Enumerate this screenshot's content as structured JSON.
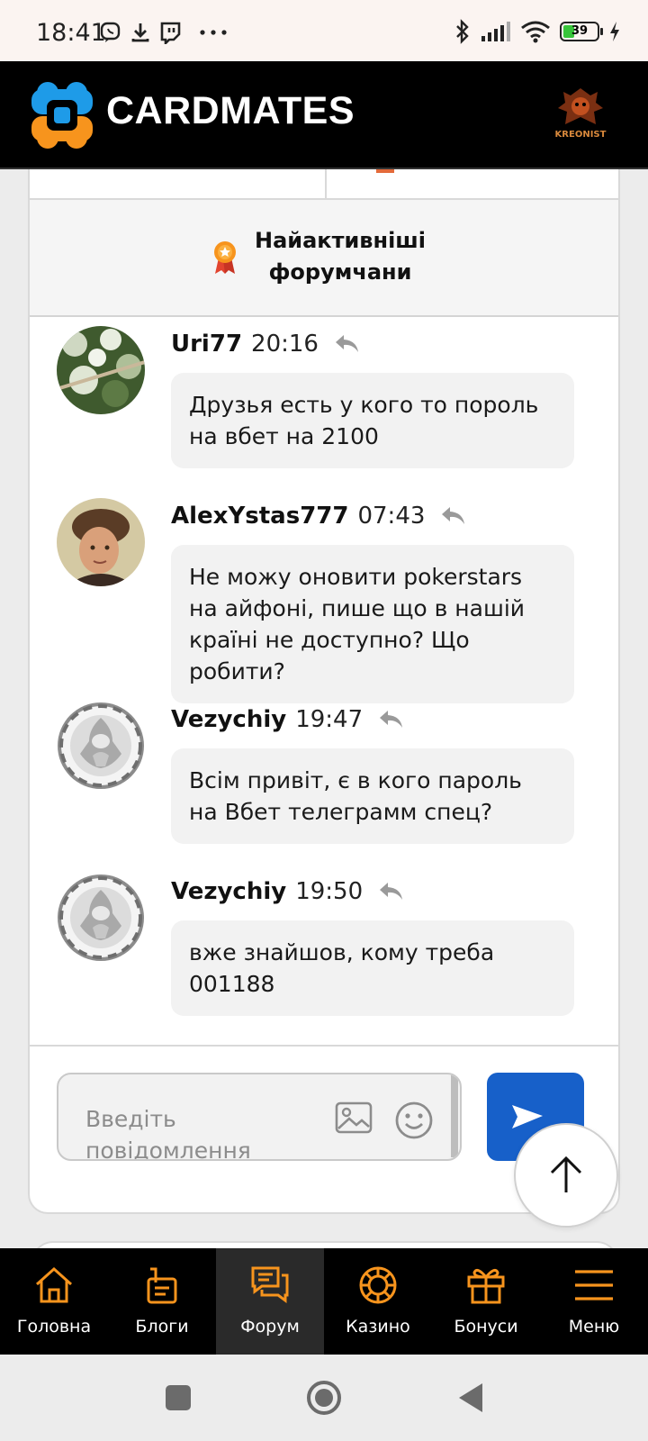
{
  "status_bar": {
    "time": "18:41",
    "left_icons": [
      "viber-icon",
      "download-icon",
      "twitch-icon",
      "more-dots-icon"
    ],
    "right_icons": [
      "bluetooth-icon",
      "signal-icon",
      "wifi-icon",
      "battery-icon",
      "charging-icon"
    ],
    "battery_level": "39"
  },
  "header": {
    "logo_text": "CARDMATES",
    "profile_badge_text": "KREONIST"
  },
  "section": {
    "title": "Найактивніші форумчани"
  },
  "messages": [
    {
      "user": "Uri77",
      "time": "20:16",
      "text": "Друзья есть у кого то пороль на вбет на 2100"
    },
    {
      "user": "AlexYstas777",
      "time": "07:43",
      "text": "Не можу оновити pokerstars на айфоні, пише що в нашій країні не доступно? Що робити?"
    },
    {
      "user": "Vezychiy",
      "time": "19:47",
      "text": "Всім привіт, є в кого пароль на Вбет телеграмм спец?"
    },
    {
      "user": "Vezychiy",
      "time": "19:50",
      "text": "вже знайшов, кому треба 001188"
    }
  ],
  "composer": {
    "placeholder": "Введіть повідомлення"
  },
  "bottom_nav": {
    "items": [
      {
        "label": "Головна",
        "icon": "home-icon"
      },
      {
        "label": "Блоги",
        "icon": "blog-icon"
      },
      {
        "label": "Форум",
        "icon": "forum-icon",
        "active": true
      },
      {
        "label": "Казино",
        "icon": "casino-chip-icon"
      },
      {
        "label": "Бонуси",
        "icon": "gift-icon"
      },
      {
        "label": "Меню",
        "icon": "menu-icon"
      }
    ]
  },
  "colors": {
    "accent_orange": "#f7941d",
    "logo_blue": "#1e9be8",
    "send_blue": "#1760c9",
    "nav_bg": "#000000"
  }
}
